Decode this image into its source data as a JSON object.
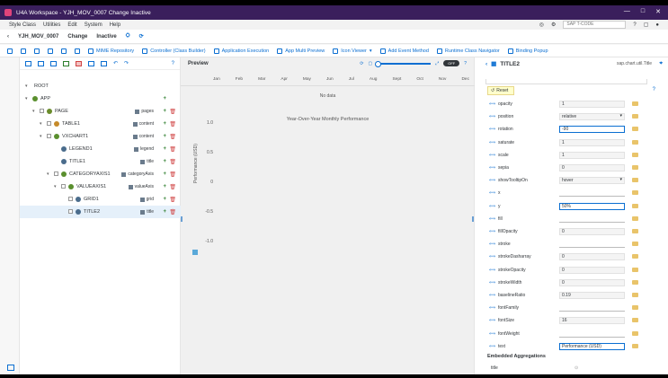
{
  "window": {
    "title": "U4A Workspace - YJH_MOV_0007 Change Inactive",
    "controls": [
      "—",
      "□",
      "✕"
    ]
  },
  "menu": {
    "items": [
      "Style Class",
      "Utilities",
      "Edit",
      "System",
      "Help"
    ],
    "tcode_placeholder": "SAP T-CODE"
  },
  "header": {
    "back": "‹",
    "app_id": "YJH_MOV_0007",
    "mode": "Change",
    "status": "Inactive"
  },
  "toolbar": {
    "items": [
      "MIME Repository",
      "Controller (Class Builder)",
      "Application Execution",
      "App Multi Preview",
      "Icon Viewer",
      "Add Event Method",
      "Runtime Class Navigator",
      "Binding Popup"
    ]
  },
  "tree": {
    "root": "ROOT",
    "nodes": [
      {
        "label": "APP",
        "agg": ""
      },
      {
        "label": "PAGE",
        "agg": "pages"
      },
      {
        "label": "TABLE1",
        "agg": "content"
      },
      {
        "label": "VXCHART1",
        "agg": "content"
      },
      {
        "label": "LEGEND1",
        "agg": "legend"
      },
      {
        "label": "TITLE1",
        "agg": "title"
      },
      {
        "label": "CATEGORYAXIS1",
        "agg": "categoryAxis"
      },
      {
        "label": "VALUEAXIS1",
        "agg": "valueAxis"
      },
      {
        "label": "GRID1",
        "agg": "grid"
      },
      {
        "label": "TITLE2",
        "agg": "title"
      }
    ]
  },
  "preview": {
    "title": "Preview",
    "toggle_label": "OFF",
    "months": [
      "Jan",
      "Feb",
      "Mar",
      "Apr",
      "May",
      "Jun",
      "Jul",
      "Aug",
      "Sept",
      "Oct",
      "Nov",
      "Dec"
    ],
    "no_data": "No data",
    "chart_title": "Year-Over-Year Monthly Performance",
    "y_label": "Performance (USD)",
    "y_ticks": [
      "1.0",
      "0.5",
      "0",
      "-0.5",
      "-1.0"
    ]
  },
  "chart_data": {
    "type": "line",
    "title": "Year-Over-Year Monthly Performance",
    "ylabel": "Performance (USD)",
    "xlabel": "",
    "ylim": [
      -1.0,
      1.0
    ],
    "y_ticks": [
      1.0,
      0.5,
      0,
      -0.5,
      -1.0
    ],
    "series": []
  },
  "properties": {
    "title": "TITLE2",
    "subtitle": "sap.chart.util.Title",
    "reset_label": "Reset",
    "rows": [
      {
        "name": "opacity",
        "value": "1",
        "kind": "input"
      },
      {
        "name": "position",
        "value": "relative",
        "kind": "select"
      },
      {
        "name": "rotation",
        "value": "-90",
        "kind": "focus"
      },
      {
        "name": "saturate",
        "value": "1",
        "kind": "input"
      },
      {
        "name": "scale",
        "value": "1",
        "kind": "input"
      },
      {
        "name": "sepia",
        "value": "0",
        "kind": "input"
      },
      {
        "name": "showTooltipOn",
        "value": "hover",
        "kind": "select"
      },
      {
        "name": "x",
        "value": "",
        "kind": "plain"
      },
      {
        "name": "y",
        "value": "50%",
        "kind": "focus"
      },
      {
        "name": "fill",
        "value": "",
        "kind": "plain"
      },
      {
        "name": "fillOpacity",
        "value": "0",
        "kind": "input"
      },
      {
        "name": "stroke",
        "value": "",
        "kind": "plain"
      },
      {
        "name": "strokeDasharray",
        "value": "0",
        "kind": "input"
      },
      {
        "name": "strokeOpacity",
        "value": "0",
        "kind": "input"
      },
      {
        "name": "strokeWidth",
        "value": "0",
        "kind": "input"
      },
      {
        "name": "baselineRatio",
        "value": "0.19",
        "kind": "input"
      },
      {
        "name": "fontFamily",
        "value": "",
        "kind": "plain"
      },
      {
        "name": "fontSize",
        "value": "16",
        "kind": "input"
      },
      {
        "name": "fontWeight",
        "value": "",
        "kind": "plain"
      },
      {
        "name": "text",
        "value": "Performance (USD)",
        "kind": "focus"
      }
    ],
    "embedded_title": "Embedded Aggregations",
    "embedded_item": "title"
  }
}
